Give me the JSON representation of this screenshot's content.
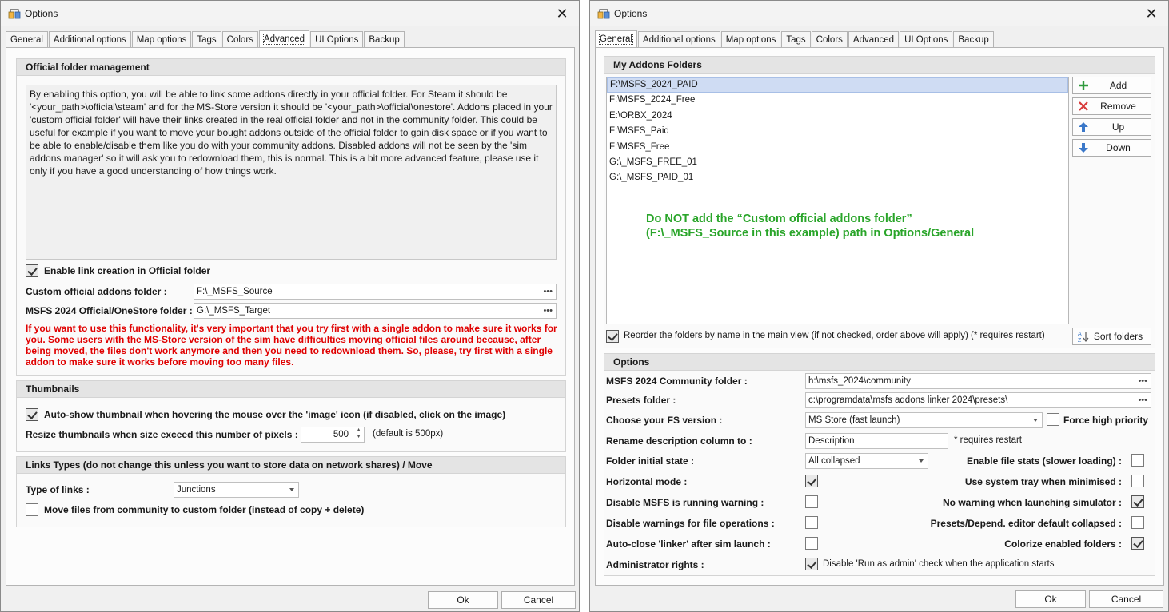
{
  "left": {
    "title": "Options",
    "tabs": [
      "General",
      "Additional options",
      "Map options",
      "Tags",
      "Colors",
      "Advanced",
      "UI Options",
      "Backup"
    ],
    "official": {
      "header": "Official folder management",
      "description": "By enabling this option, you will be able to link some addons directly in your official folder. For Steam it should be '<your_path>\\official\\steam' and for the MS-Store version it should be '<your_path>\\official\\onestore'. Addons placed in your 'custom official folder' will have their links created in the real official folder and not in the community folder. This could be useful for example if you want to move your bought addons outside of the official folder to gain disk space or if you want to be able to enable/disable them like you do with your community addons. Disabled addons will not be seen by the 'sim addons manager' so it will ask you to redownload them, this is normal. This is a bit more advanced feature, please use it only if you have a good understanding of how things work.",
      "enable_label": "Enable link creation in Official folder",
      "custom_label": "Custom official addons folder :",
      "custom_value": "F:\\_MSFS_Source",
      "target_label": "MSFS 2024 Official/OneStore folder :",
      "target_value": "G:\\_MSFS_Target",
      "warning": "If you want to use this functionality, it's very important that you try first with a single addon to make sure it works for you. Some users with the MS-Store version of the sim have difficulties moving official files around because, after being moved, the files don't work anymore and then you need to redownload them. So, please, try first with a single addon to make sure it works before moving too many files."
    },
    "thumbs": {
      "header": "Thumbnails",
      "autoshow_label": "Auto-show thumbnail when hovering the mouse over the 'image' icon (if disabled, click on the image)",
      "resize_label": "Resize thumbnails when size exceed this number of pixels :",
      "resize_value": "500",
      "default_note": "(default is 500px)"
    },
    "links": {
      "header": "Links Types (do not change this unless you want to store data on network shares) / Move",
      "type_label": "Type of links :",
      "type_value": "Junctions",
      "move_label": "Move files from community to custom folder (instead of copy + delete)"
    },
    "ok": "Ok",
    "cancel": "Cancel"
  },
  "right": {
    "title": "Options",
    "tabs": [
      "General",
      "Additional options",
      "Map options",
      "Tags",
      "Colors",
      "Advanced",
      "UI Options",
      "Backup"
    ],
    "addons": {
      "header": "My Addons Folders",
      "folders": [
        "F:\\MSFS_2024_PAID",
        "F:\\MSFS_2024_Free",
        "E:\\ORBX_2024",
        "F:\\MSFS_Paid",
        "F:\\MSFS_Free",
        "G:\\_MSFS_FREE_01",
        "G:\\_MSFS_PAID_01"
      ],
      "add": "Add",
      "remove": "Remove",
      "up": "Up",
      "down": "Down",
      "note_line1": "Do NOT add the “Custom official addons folder”",
      "note_line2": "(F:\\_MSFS_Source in this example) path in Options/General",
      "reorder_label": "Reorder the folders by name in the main view (if not checked, order above will apply) (* requires restart)",
      "sort": "Sort folders"
    },
    "options": {
      "header": "Options",
      "community_label": "MSFS 2024 Community folder :",
      "community_value": "h:\\msfs_2024\\community",
      "presets_label": "Presets folder :",
      "presets_value": "c:\\programdata\\msfs addons linker 2024\\presets\\",
      "fsver_label": "Choose your FS version :",
      "fsver_value": "MS Store (fast launch)",
      "force_label": "Force high priority",
      "rename_label": "Rename description column to :",
      "rename_value": "Description",
      "restart_note": "* requires restart",
      "initial_label": "Folder initial state :",
      "initial_value": "All collapsed",
      "filestats_label": "Enable file stats (slower loading) :",
      "horizontal_label": "Horizontal mode :",
      "tray_label": "Use system tray when minimised :",
      "disable_running_label": "Disable MSFS is running warning :",
      "nowarn_label": "No warning when launching simulator :",
      "disable_fileops_label": "Disable warnings for file operations :",
      "presets_collapsed_label": "Presets/Depend. editor default collapsed :",
      "autoclose_label": "Auto-close 'linker' after sim launch :",
      "colorize_label": "Colorize enabled folders :",
      "admin_label": "Administrator rights :",
      "admin_check_label": "Disable 'Run as admin' check when the application starts"
    },
    "ok": "Ok",
    "cancel": "Cancel"
  }
}
